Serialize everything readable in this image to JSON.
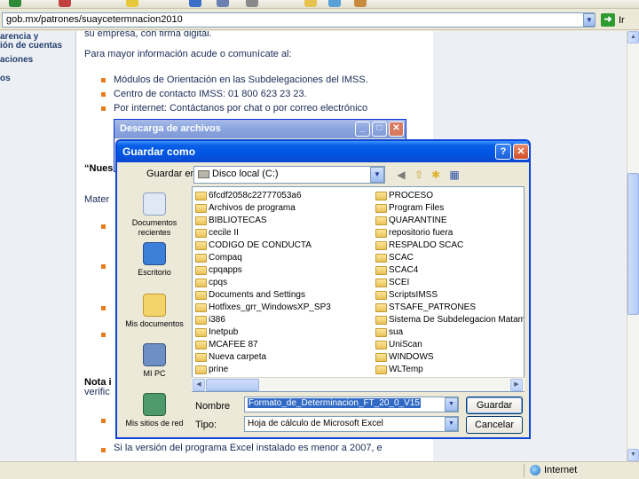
{
  "browser": {
    "address": "gob.mx/patrones/suaycetermnacion2010",
    "go_label": "Ir",
    "status_zone": "Internet"
  },
  "leftnav": {
    "items": [
      "arencia y",
      "ión de cuentas",
      "aciones",
      "os"
    ]
  },
  "page": {
    "line1": "su empresa, con firma digital.",
    "line2": "Para mayor información acude o comunícate al:",
    "bullets": [
      "Módulos de Orientación en las Subdelegaciones del IMSS.",
      "Centro de contacto IMSS: 01 800 623 23 23.",
      "Por internet: Contáctanos por chat o por correo electrónico"
    ],
    "heading": "“Nues",
    "mater": "Mater",
    "nota": "Nota i",
    "verific": "verific",
    "last_bullet": "Si la versión del programa Excel instalado es menor a 2007, e"
  },
  "download_dialog": {
    "title": "Descarga de archivos"
  },
  "save_dialog": {
    "title": "Guardar como",
    "save_in_label": "Guardar en:",
    "save_in_value": "Disco local (C:)",
    "places": [
      "Documentos recientes",
      "Escritorio",
      "Mis documentos",
      "MI PC",
      "Mis sitios de red"
    ],
    "folders_col1": [
      "6fcdf2058c22777053a6",
      "Archivos de programa",
      "BIBLIOTECAS",
      "cecile II",
      "CODIGO DE CONDUCTA",
      "Compaq",
      "cpqapps",
      "cpqs",
      "Documents and Settings",
      "Hotfixes_grr_WindowsXP_SP3",
      "i386",
      "Inetpub",
      "MCAFEE 87",
      "Nueva carpeta",
      "prine"
    ],
    "folders_col2": [
      "PROCESO",
      "Program Files",
      "QUARANTINE",
      "repositorio fuera",
      "RESPALDO SCAC",
      "SCAC",
      "SCAC4",
      "SCEI",
      "ScriptsIMSS",
      "STSAFE_PATRONES",
      "Sistema De Subdelegacion Matamoros",
      "sua",
      "UniScan",
      "WINDOWS",
      "WLTemp"
    ],
    "name_label": "Nombre",
    "name_value": "Formato_de_Determinacion_FT_20_0_V15",
    "type_label": "Tipo:",
    "type_value": "Hoja de cálculo de Microsoft Excel",
    "save_button": "Guardar",
    "cancel_button": "Cancelar"
  }
}
